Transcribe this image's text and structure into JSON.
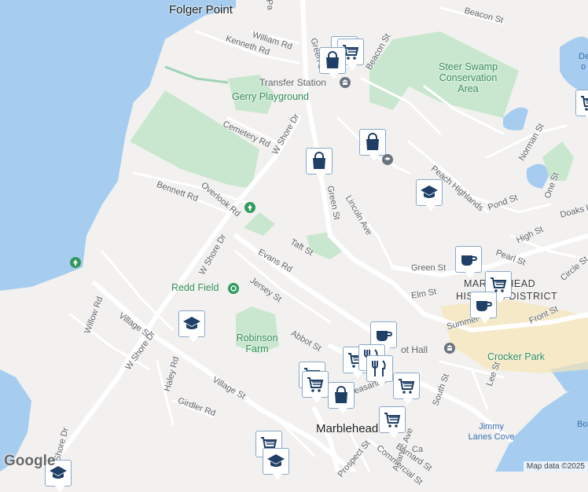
{
  "map": {
    "place_labels": [
      "Folger Point",
      "Marblehead"
    ],
    "park_labels": [
      "Gerry Playground",
      "Steer Swamp Conservation Area",
      "Redd Field",
      "Robinson Farm",
      "Crocker Park"
    ],
    "district_labels": [
      "MARBLEHEAD",
      "HISTORIC DISTRICT"
    ],
    "water_labels": [
      "Jimmy Lanes Cove",
      "Bo",
      "De o"
    ],
    "poi_labels": [
      "Transfer Station",
      "ot Hall"
    ],
    "street_labels": [
      "Beacon St",
      "William Rd",
      "Kenneth Rd",
      "Green St",
      "Beacon St",
      "Cemetery Rd",
      "W Shore Dr",
      "Bennett Rd",
      "Overlook Rd",
      "Lincoln Ave",
      "Green St",
      "Peach Highlands",
      "Pond St",
      "Norman St",
      "One St",
      "Doaks Ln",
      "High St",
      "Taft St",
      "Evans Rd",
      "W Shore Dr",
      "Jersey St",
      "Green St",
      "Pearl St",
      "Circle St",
      "Elm St",
      "Willow Rd",
      "Village St",
      "W Shore Dr",
      "Abbot St",
      "Summer",
      "Front St",
      "Haley Rd",
      "Village St",
      "Girdler Rd",
      "Lee St",
      "Pleasant St",
      "South St",
      "Prospect St",
      "Atlantic Ave",
      "Barnard St",
      "Ca",
      "Commercial St",
      "W Shore Dr",
      "Pa"
    ],
    "markers": [
      {
        "kind": "bag"
      },
      {
        "kind": "cart"
      },
      {
        "kind": "bag"
      },
      {
        "kind": "bag"
      },
      {
        "kind": "school"
      },
      {
        "kind": "cart"
      },
      {
        "kind": "coffee"
      },
      {
        "kind": "cart"
      },
      {
        "kind": "coffee"
      },
      {
        "kind": "school"
      },
      {
        "kind": "coffee"
      },
      {
        "kind": "cart"
      },
      {
        "kind": "food"
      },
      {
        "kind": "food"
      },
      {
        "kind": "cart"
      },
      {
        "kind": "bag"
      },
      {
        "kind": "cart"
      },
      {
        "kind": "cart"
      },
      {
        "kind": "cart"
      },
      {
        "kind": "school"
      },
      {
        "kind": "school"
      }
    ]
  },
  "branding": {
    "logo": "Google",
    "attribution": "Map data ©2025"
  },
  "colors": {
    "water": "#a6cdf0",
    "land": "#f2f1ef",
    "park": "#c9e7cf",
    "road": "#ffffff",
    "pin_icon": "#1f3f66",
    "district": "#f6e5b7"
  }
}
